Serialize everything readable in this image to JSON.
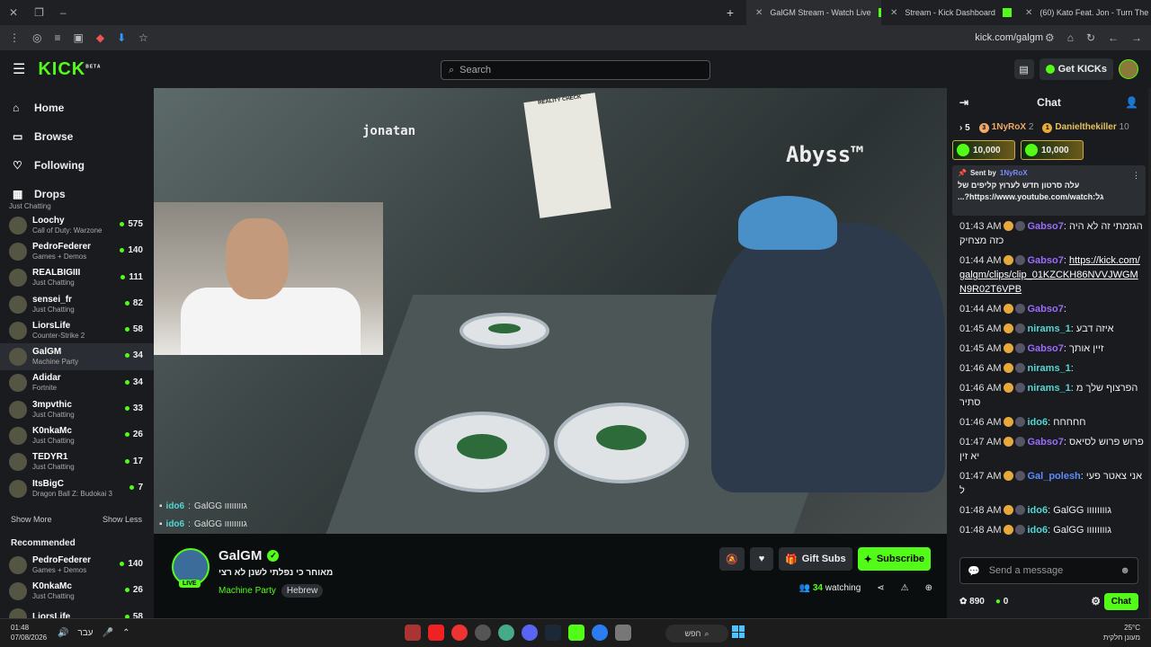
{
  "browser": {
    "tabs": [
      {
        "title": "GalGM Stream - Watch Live",
        "active": true
      },
      {
        "title": "Stream - Kick Dashboard",
        "active": false
      },
      {
        "title": "(60) Kato Feat. Jon - Turn The L",
        "active": false
      }
    ],
    "url": "kick.com/galgm"
  },
  "header": {
    "logo": "KICK",
    "beta": "BETA",
    "search_placeholder": "Search",
    "get_kicks": "Get KICKs"
  },
  "nav": [
    {
      "label": "Home",
      "icon": "home-icon"
    },
    {
      "label": "Browse",
      "icon": "browse-icon"
    },
    {
      "label": "Following",
      "icon": "heart-icon"
    },
    {
      "label": "Drops",
      "icon": "drops-icon"
    }
  ],
  "following": [
    {
      "name": "",
      "game": "Just Chatting",
      "viewers": ""
    },
    {
      "name": "Loochy",
      "game": "Call of Duty: Warzone",
      "viewers": "575"
    },
    {
      "name": "PedroFederer",
      "game": "Games + Demos",
      "viewers": "140"
    },
    {
      "name": "REALBIGIII",
      "game": "Just Chatting",
      "viewers": "111"
    },
    {
      "name": "sensei_fr",
      "game": "Just Chatting",
      "viewers": "82"
    },
    {
      "name": "LiorsLife",
      "game": "Counter-Strike 2",
      "viewers": "58"
    },
    {
      "name": "GalGM",
      "game": "Machine Party",
      "viewers": "34"
    },
    {
      "name": "Adidar",
      "game": "Fortnite",
      "viewers": "34"
    },
    {
      "name": "3mpvthic",
      "game": "Just Chatting",
      "viewers": "33"
    },
    {
      "name": "K0nkaMc",
      "game": "Just Chatting",
      "viewers": "26"
    },
    {
      "name": "TEDYR1",
      "game": "Just Chatting",
      "viewers": "17"
    },
    {
      "name": "ItsBigC",
      "game": "Dragon Ball Z: Budokai 3",
      "viewers": "7"
    }
  ],
  "show_more": "Show More",
  "show_less": "Show Less",
  "recommended_title": "Recommended",
  "recommended": [
    {
      "name": "PedroFederer",
      "game": "Games + Demos",
      "viewers": "140"
    },
    {
      "name": "K0nkaMc",
      "game": "Just Chatting",
      "viewers": "26"
    },
    {
      "name": "LiorsLife",
      "game": "",
      "viewers": "58"
    }
  ],
  "video": {
    "label1": "jonatan",
    "label2": "Abyss™",
    "newspaper": "REALITY CHECK",
    "overlay": [
      {
        "user": "ido6",
        "text": "GalGG גוווווווו"
      },
      {
        "user": "ido6",
        "text": "GalGG גוווווווו"
      }
    ]
  },
  "stream": {
    "name": "GalGM",
    "live": "LIVE",
    "title": "מאוחר כי נפלתי לשנן לא רצי",
    "game": "Machine Party",
    "language": "Hebrew",
    "watching_count": "34",
    "watching_label": "watching",
    "gift_subs": "Gift Subs",
    "subscribe": "Subscribe"
  },
  "chat": {
    "title": "Chat",
    "gifters": [
      {
        "rank": "5",
        "name": ""
      },
      {
        "rank": "3",
        "name": "1NyRoX",
        "count": "2"
      },
      {
        "rank": "1",
        "name": "Danielthekiller",
        "count": "10"
      }
    ],
    "kicks": [
      "10,000",
      "10,000"
    ],
    "pinned": {
      "sent_by": "Sent by",
      "user": "1NyRoX",
      "text": "עלה סרטון חדש לערוץ קליפים של גל:https://www.youtube.com/watch?..."
    },
    "messages": [
      {
        "time": "01:43 AM",
        "user": "Gabso7",
        "color": "#9b6cff",
        "text": "הגזמתי זה לא היה כזה מצחיק"
      },
      {
        "time": "01:44 AM",
        "user": "Gabso7",
        "color": "#9b6cff",
        "text": "https://kick.com/galgm/clips/clip_01KZCKH86NVVJWGMN9R02T6VPB"
      },
      {
        "time": "01:44 AM",
        "user": "Gabso7",
        "color": "#9b6cff",
        "text": ""
      },
      {
        "time": "01:45 AM",
        "user": "nirams_1",
        "color": "#53d7d4",
        "text": "איזה דבע"
      },
      {
        "time": "01:45 AM",
        "user": "Gabso7",
        "color": "#9b6cff",
        "text": "זיין אותך"
      },
      {
        "time": "01:46 AM",
        "user": "nirams_1",
        "color": "#53d7d4",
        "text": ""
      },
      {
        "time": "01:46 AM",
        "user": "nirams_1",
        "color": "#53d7d4",
        "text": "הפרצוף שלך מסתיר"
      },
      {
        "time": "01:46 AM",
        "user": "ido6",
        "color": "#53d7d4",
        "text": "חחחחח"
      },
      {
        "time": "01:47 AM",
        "user": "Gabso7",
        "color": "#9b6cff",
        "text": "פרוש פרוש לסיאס יא זין"
      },
      {
        "time": "01:47 AM",
        "user": "Gal_polesh",
        "color": "#5a8cff",
        "text": "אני צאטר פעיל"
      },
      {
        "time": "01:48 AM",
        "user": "ido6",
        "color": "#53d7d4",
        "text": "GalGG גוווווווו"
      },
      {
        "time": "01:48 AM",
        "user": "ido6",
        "color": "#53d7d4",
        "text": "GalGG גוווווווו"
      }
    ],
    "input_placeholder": "Send a message",
    "kicks_balance": "890",
    "points": "0",
    "chat_button": "Chat"
  },
  "taskbar": {
    "time": "01:48",
    "date": "07/08/2026",
    "lang": "עבר",
    "search": "חפש",
    "temp": "25°C",
    "weather": "מעונן חלקית"
  }
}
